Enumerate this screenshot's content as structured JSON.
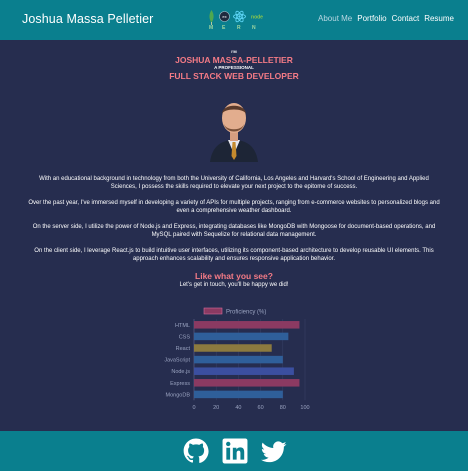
{
  "header": {
    "brand": "Joshua Massa Pelletier",
    "stack_icons": [
      "mongodb-icon",
      "express-icon",
      "react-icon",
      "node-icon"
    ],
    "stack_letters": [
      "M",
      "E",
      "R",
      "N"
    ],
    "nav": [
      {
        "label": "About Me",
        "active": true
      },
      {
        "label": "Portfolio",
        "active": false
      },
      {
        "label": "Contact",
        "active": false
      },
      {
        "label": "Resume",
        "active": false
      }
    ]
  },
  "hero": {
    "intro": "I'M",
    "name": "JOSHUA MASSA-PELLETIER",
    "prefix": "A PROFESSIONAL",
    "role": "FULL STACK WEB DEVELOPER"
  },
  "about": [
    "With an educational background in technology from both the University of California, Los Angeles and Harvard's School of Engineering and Applied Sciences, I possess the skills required to elevate your next project to the epitome of success.",
    "Over the past year, I've immersed myself in developing a variety of APIs for multiple projects, ranging from e-commerce websites to personalized blogs and even a comprehensive weather dashboard.",
    "On the server side, I utilize the power of Node.js and Express, integrating databases like MongoDB with Mongoose for document-based operations, and MySQL paired with Sequelize for relational data management.",
    "On the client side, I leverage React.js to build intuitive user interfaces, utilizing its component-based architecture to develop reusable UI elements. This approach enhances scalability and ensures responsive application behavior."
  ],
  "cta": {
    "title": "Like what you see?",
    "subtitle": "Let's get in touch, you'll be happy we did!"
  },
  "chart_data": {
    "type": "bar",
    "orientation": "horizontal",
    "categories": [
      "HTML",
      "CSS",
      "React",
      "JavaScript",
      "Node.js",
      "Express",
      "MongoDB"
    ],
    "series": [
      {
        "name": "Proficiency (%)",
        "values": [
          95,
          85,
          70,
          80,
          90,
          95,
          80
        ]
      }
    ],
    "colors": [
      "#8b3a62",
      "#2f5f9a",
      "#8c7a3f",
      "#2f5f9a",
      "#3b4fa0",
      "#8b3a62",
      "#2f5f9a"
    ],
    "xlim": [
      0,
      100
    ],
    "xticks": [
      0,
      20,
      40,
      60,
      80,
      100
    ],
    "grid": true,
    "legend": "top"
  },
  "footer": {
    "icons": [
      "github-icon",
      "linkedin-icon",
      "twitter-icon"
    ]
  },
  "colors": {
    "bar": "#0a7f8e",
    "background": "#262d4f",
    "accent": "#f47b86"
  }
}
